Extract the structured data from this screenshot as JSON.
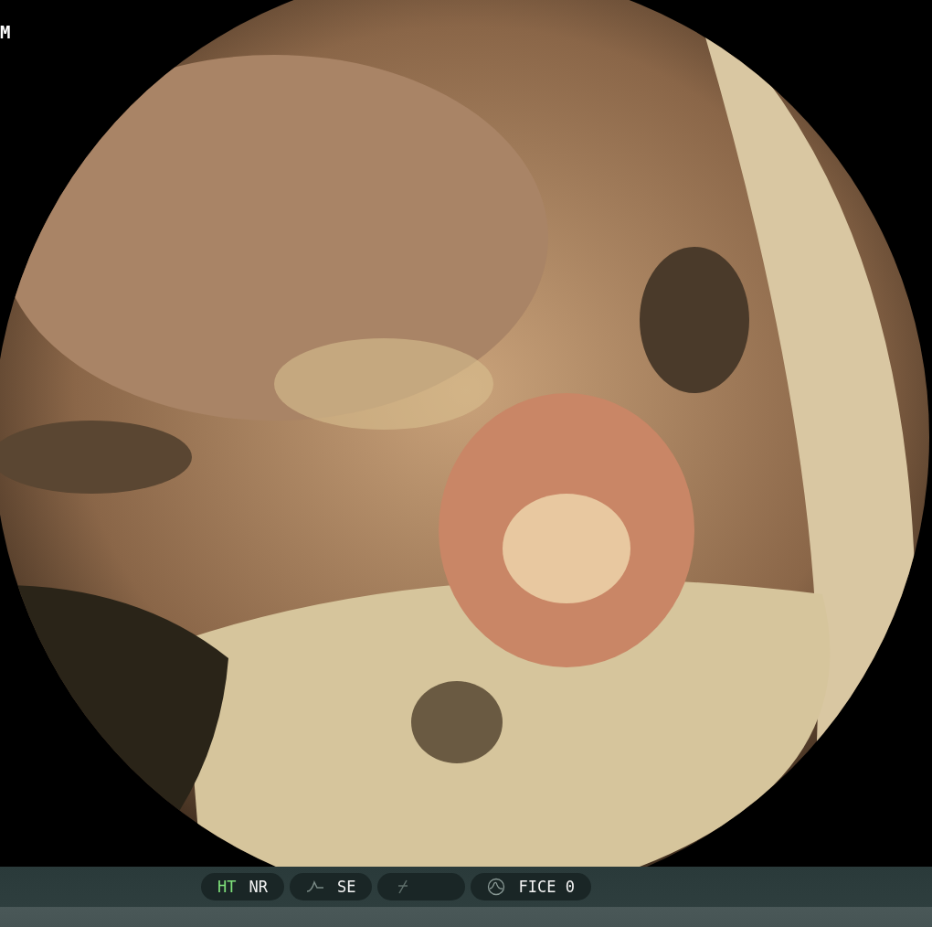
{
  "corner_text": "M",
  "status_bar": {
    "groups": [
      {
        "kind": "plain",
        "items": [
          {
            "text": "HT",
            "active": true
          },
          {
            "text": "NR",
            "active": false
          }
        ]
      },
      {
        "kind": "curve",
        "items": [
          {
            "text": "SE",
            "active": false
          }
        ]
      },
      {
        "kind": "slash"
      },
      {
        "kind": "wave",
        "items": [
          {
            "text": "FICE 0",
            "active": false
          }
        ]
      }
    ]
  }
}
